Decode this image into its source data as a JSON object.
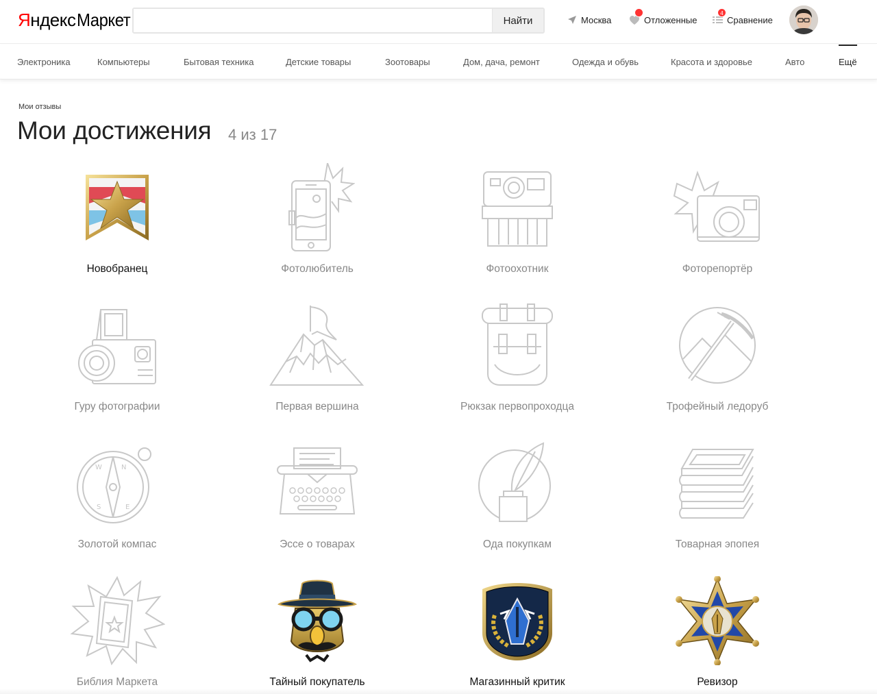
{
  "header": {
    "logo_part1": "Я",
    "logo_part2": "ндекс",
    "logo_part3": "Маркет",
    "search_placeholder": "",
    "search_button": "Найти",
    "location": "Москва",
    "favorites": "Отложенные",
    "compare": "Сравнение",
    "compare_count": "4"
  },
  "nav": {
    "items": [
      "Электроника",
      "Компьютеры",
      "Бытовая техника",
      "Детские товары",
      "Зоотовары",
      "Дом, дача, ремонт",
      "Одежда и обувь",
      "Красота и здоровье",
      "Авто",
      "Ещё"
    ]
  },
  "breadcrumb": "Мои отзывы",
  "title": "Мои достижения",
  "progress": "4 из 17",
  "achievements": [
    {
      "name": "Новобранец",
      "earned": true,
      "icon": "recruit-badge-icon"
    },
    {
      "name": "Фотолюбитель",
      "earned": false,
      "icon": "phone-photo-icon"
    },
    {
      "name": "Фотоохотник",
      "earned": false,
      "icon": "instant-camera-icon"
    },
    {
      "name": "Фоторепортёр",
      "earned": false,
      "icon": "compact-camera-flash-icon"
    },
    {
      "name": "Гуру фотографии",
      "earned": false,
      "icon": "medium-format-camera-icon"
    },
    {
      "name": "Первая вершина",
      "earned": false,
      "icon": "mountain-flag-icon"
    },
    {
      "name": "Рюкзак первопроходца",
      "earned": false,
      "icon": "backpack-icon"
    },
    {
      "name": "Трофейный ледоруб",
      "earned": false,
      "icon": "ice-axe-icon"
    },
    {
      "name": "Золотой компас",
      "earned": false,
      "icon": "compass-icon"
    },
    {
      "name": "Эссе о товарах",
      "earned": false,
      "icon": "typewriter-icon"
    },
    {
      "name": "Ода покупкам",
      "earned": false,
      "icon": "quill-inkwell-icon"
    },
    {
      "name": "Товарная эпопея",
      "earned": false,
      "icon": "paper-stack-icon"
    },
    {
      "name": "Библия Маркета",
      "earned": false,
      "icon": "book-burst-icon"
    },
    {
      "name": "Тайный покупатель",
      "earned": true,
      "icon": "disguise-spy-icon"
    },
    {
      "name": "Магазинный критик",
      "earned": true,
      "icon": "critic-shield-icon"
    },
    {
      "name": "Ревизор",
      "earned": true,
      "icon": "sheriff-star-icon"
    }
  ]
}
